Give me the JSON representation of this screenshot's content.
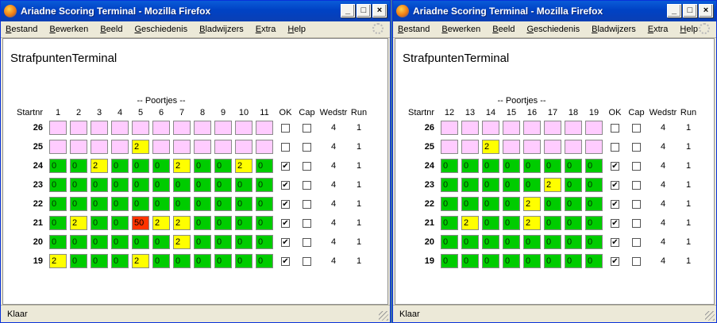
{
  "windows": [
    {
      "title": "Ariadne Scoring Terminal - Mozilla Firefox",
      "menu": [
        "Bestand",
        "Bewerken",
        "Beeld",
        "Geschiedenis",
        "Bladwijzers",
        "Extra",
        "Help"
      ],
      "app_title": "StrafpuntenTerminal",
      "group_label": "-- Poortjes --",
      "columns": {
        "startnr": "Startnr",
        "ok": "OK",
        "cap": "Cap",
        "wedstr": "Wedstr",
        "run": "Run"
      },
      "gates": [
        "1",
        "2",
        "3",
        "4",
        "5",
        "6",
        "7",
        "8",
        "9",
        "10",
        "11"
      ],
      "rows": [
        {
          "startnr": "26",
          "cells": [
            "",
            "",
            "",
            "",
            "",
            "",
            "",
            "",
            "",
            "",
            ""
          ],
          "colors": [
            "pink",
            "pink",
            "pink",
            "pink",
            "pink",
            "pink",
            "pink",
            "pink",
            "pink",
            "pink",
            "pink"
          ],
          "ok": false,
          "cap": false,
          "wedstr": "4",
          "run": "1"
        },
        {
          "startnr": "25",
          "cells": [
            "",
            "",
            "",
            "",
            "2",
            "",
            "",
            "",
            "",
            "",
            ""
          ],
          "colors": [
            "pink",
            "pink",
            "pink",
            "pink",
            "yellow",
            "pink",
            "pink",
            "pink",
            "pink",
            "pink",
            "pink"
          ],
          "ok": false,
          "cap": false,
          "wedstr": "4",
          "run": "1"
        },
        {
          "startnr": "24",
          "cells": [
            "0",
            "0",
            "2",
            "0",
            "0",
            "0",
            "2",
            "0",
            "0",
            "2",
            "0"
          ],
          "colors": [
            "green",
            "green",
            "yellow",
            "green",
            "green",
            "green",
            "yellow",
            "green",
            "green",
            "yellow",
            "green"
          ],
          "ok": true,
          "cap": false,
          "wedstr": "4",
          "run": "1"
        },
        {
          "startnr": "23",
          "cells": [
            "0",
            "0",
            "0",
            "0",
            "0",
            "0",
            "0",
            "0",
            "0",
            "0",
            "0"
          ],
          "colors": [
            "green",
            "green",
            "green",
            "green",
            "green",
            "green",
            "green",
            "green",
            "green",
            "green",
            "green"
          ],
          "ok": true,
          "cap": false,
          "wedstr": "4",
          "run": "1"
        },
        {
          "startnr": "22",
          "cells": [
            "0",
            "0",
            "0",
            "0",
            "0",
            "0",
            "0",
            "0",
            "0",
            "0",
            "0"
          ],
          "colors": [
            "green",
            "green",
            "green",
            "green",
            "green",
            "green",
            "green",
            "green",
            "green",
            "green",
            "green"
          ],
          "ok": true,
          "cap": false,
          "wedstr": "4",
          "run": "1"
        },
        {
          "startnr": "21",
          "cells": [
            "0",
            "2",
            "0",
            "0",
            "50",
            "2",
            "2",
            "0",
            "0",
            "0",
            "0"
          ],
          "colors": [
            "green",
            "yellow",
            "green",
            "green",
            "red",
            "yellow",
            "yellow",
            "green",
            "green",
            "green",
            "green"
          ],
          "ok": true,
          "cap": false,
          "wedstr": "4",
          "run": "1"
        },
        {
          "startnr": "20",
          "cells": [
            "0",
            "0",
            "0",
            "0",
            "0",
            "0",
            "2",
            "0",
            "0",
            "0",
            "0"
          ],
          "colors": [
            "green",
            "green",
            "green",
            "green",
            "green",
            "green",
            "yellow",
            "green",
            "green",
            "green",
            "green"
          ],
          "ok": true,
          "cap": false,
          "wedstr": "4",
          "run": "1"
        },
        {
          "startnr": "19",
          "cells": [
            "2",
            "0",
            "0",
            "0",
            "2",
            "0",
            "0",
            "0",
            "0",
            "0",
            "0"
          ],
          "colors": [
            "yellow",
            "green",
            "green",
            "green",
            "yellow",
            "green",
            "green",
            "green",
            "green",
            "green",
            "green"
          ],
          "ok": true,
          "cap": false,
          "wedstr": "4",
          "run": "1"
        }
      ],
      "status": "Klaar"
    },
    {
      "title": "Ariadne Scoring Terminal - Mozilla Firefox",
      "menu": [
        "Bestand",
        "Bewerken",
        "Beeld",
        "Geschiedenis",
        "Bladwijzers",
        "Extra",
        "Help"
      ],
      "app_title": "StrafpuntenTerminal",
      "group_label": "-- Poortjes --",
      "columns": {
        "startnr": "Startnr",
        "ok": "OK",
        "cap": "Cap",
        "wedstr": "Wedstr",
        "run": "Run"
      },
      "gates": [
        "12",
        "13",
        "14",
        "15",
        "16",
        "17",
        "18",
        "19"
      ],
      "rows": [
        {
          "startnr": "26",
          "cells": [
            "",
            "",
            "",
            "",
            "",
            "",
            "",
            ""
          ],
          "colors": [
            "pink",
            "pink",
            "pink",
            "pink",
            "pink",
            "pink",
            "pink",
            "pink"
          ],
          "ok": false,
          "cap": false,
          "wedstr": "4",
          "run": "1"
        },
        {
          "startnr": "25",
          "cells": [
            "",
            "",
            "2",
            "",
            "",
            "",
            "",
            ""
          ],
          "colors": [
            "pink",
            "pink",
            "yellow",
            "pink",
            "pink",
            "pink",
            "pink",
            "pink"
          ],
          "ok": false,
          "cap": false,
          "wedstr": "4",
          "run": "1"
        },
        {
          "startnr": "24",
          "cells": [
            "0",
            "0",
            "0",
            "0",
            "0",
            "0",
            "0",
            "0"
          ],
          "colors": [
            "green",
            "green",
            "green",
            "green",
            "green",
            "green",
            "green",
            "green"
          ],
          "ok": true,
          "cap": false,
          "wedstr": "4",
          "run": "1"
        },
        {
          "startnr": "23",
          "cells": [
            "0",
            "0",
            "0",
            "0",
            "0",
            "2",
            "0",
            "0"
          ],
          "colors": [
            "green",
            "green",
            "green",
            "green",
            "green",
            "yellow",
            "green",
            "green"
          ],
          "ok": true,
          "cap": false,
          "wedstr": "4",
          "run": "1"
        },
        {
          "startnr": "22",
          "cells": [
            "0",
            "0",
            "0",
            "0",
            "2",
            "0",
            "0",
            "0"
          ],
          "colors": [
            "green",
            "green",
            "green",
            "green",
            "yellow",
            "green",
            "green",
            "green"
          ],
          "ok": true,
          "cap": false,
          "wedstr": "4",
          "run": "1"
        },
        {
          "startnr": "21",
          "cells": [
            "0",
            "2",
            "0",
            "0",
            "2",
            "0",
            "0",
            "0"
          ],
          "colors": [
            "green",
            "yellow",
            "green",
            "green",
            "yellow",
            "green",
            "green",
            "green"
          ],
          "ok": true,
          "cap": false,
          "wedstr": "4",
          "run": "1"
        },
        {
          "startnr": "20",
          "cells": [
            "0",
            "0",
            "0",
            "0",
            "0",
            "0",
            "0",
            "0"
          ],
          "colors": [
            "green",
            "green",
            "green",
            "green",
            "green",
            "green",
            "green",
            "green"
          ],
          "ok": true,
          "cap": false,
          "wedstr": "4",
          "run": "1"
        },
        {
          "startnr": "19",
          "cells": [
            "0",
            "0",
            "0",
            "0",
            "0",
            "0",
            "0",
            "0"
          ],
          "colors": [
            "green",
            "green",
            "green",
            "green",
            "green",
            "green",
            "green",
            "green"
          ],
          "ok": true,
          "cap": false,
          "wedstr": "4",
          "run": "1"
        }
      ],
      "status": "Klaar"
    }
  ],
  "colors": {
    "pink": "#ffccff",
    "green": "#00cc00",
    "yellow": "#ffff00",
    "red": "#ff3300"
  },
  "icons": {
    "window_icon": "firefox-icon",
    "minimize": "minimize-icon",
    "maximize": "maximize-icon",
    "close": "close-icon",
    "busy": "throbber-icon"
  }
}
